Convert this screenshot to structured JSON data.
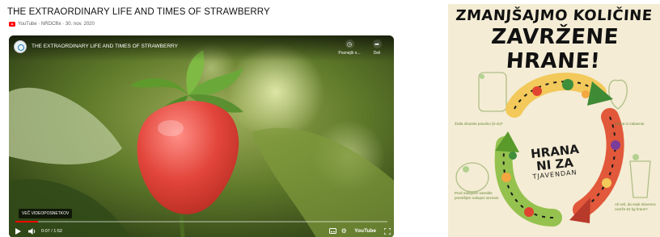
{
  "header": {
    "title": "THE EXTRAORDINARY LIFE AND TIMES OF STRAWBERRY",
    "source": "YouTube · NRDCflix · 30. nov. 2020"
  },
  "video": {
    "title": "THE EXTRAORDINARY LIFE AND TIMES OF STRAWBERRY",
    "watch_later_label": "Poznejši o...",
    "share_label": "Deli",
    "watch_more_label": "VEČ VIDEOPOSNETKOV",
    "time": "0:07 / 1:52",
    "progress": 0.06,
    "brand": "YouTube",
    "accent_color": "#ff0000"
  },
  "poster": {
    "headline_line1": "ZMANJŠAJMO KOLIČINE",
    "headline_line2": "ZAVRŽENE HRANE!",
    "center_line1": "HRANA",
    "center_line2": "NI ZA",
    "center_line3": "TJAVENDAN",
    "note_top_left": "Živila shranite pravilno (0-4o)*",
    "note_top_right": "Hrana ni zabavna!",
    "note_bottom_left": "Pred nakupom naredite premišljen nakupni seznam",
    "note_bottom_right": "Ali veš, da vsak Slovenec zavrže 62 kg hrane?"
  }
}
